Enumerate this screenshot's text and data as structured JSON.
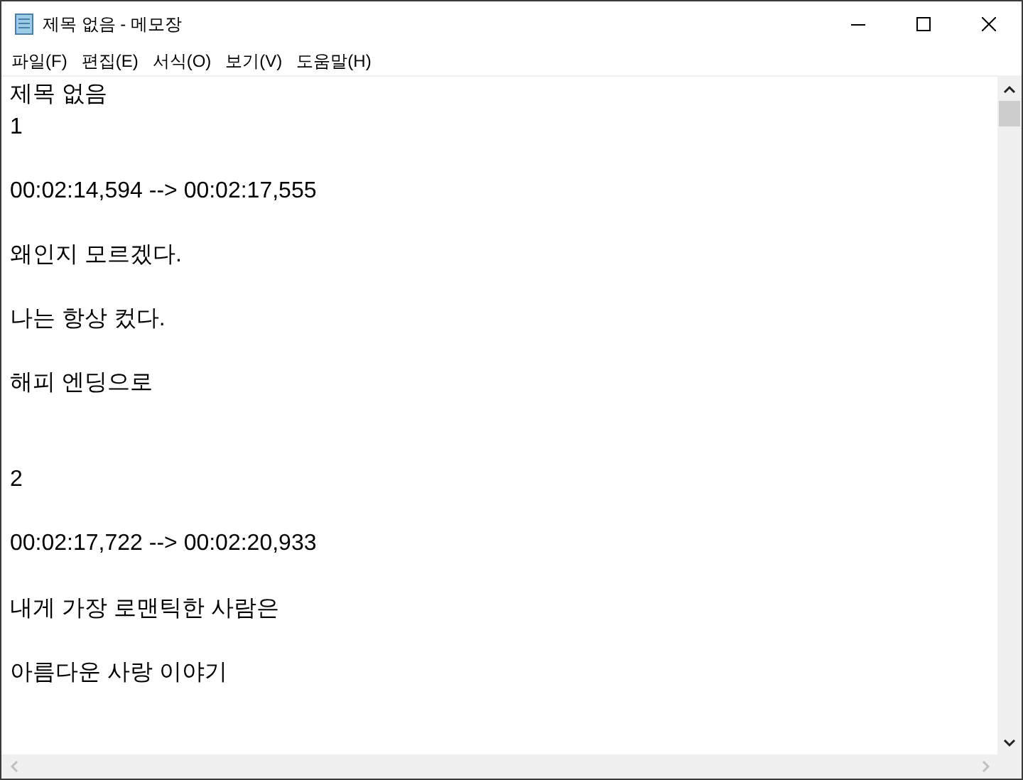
{
  "window": {
    "title": "제목 없음 - 메모장"
  },
  "menu": [
    "파일(F)",
    "편집(E)",
    "서식(O)",
    "보기(V)",
    "도움말(H)"
  ],
  "document": {
    "content": "제목 없음\n1\n\n00:02:14,594 --> 00:02:17,555\n\n왜인지 모르겠다.\n\n나는 항상 컸다.\n\n해피 엔딩으로\n\n\n2\n\n00:02:17,722 --> 00:02:20,933\n\n내게 가장 로맨틱한 사람은\n\n아름다운 사랑 이야기"
  }
}
